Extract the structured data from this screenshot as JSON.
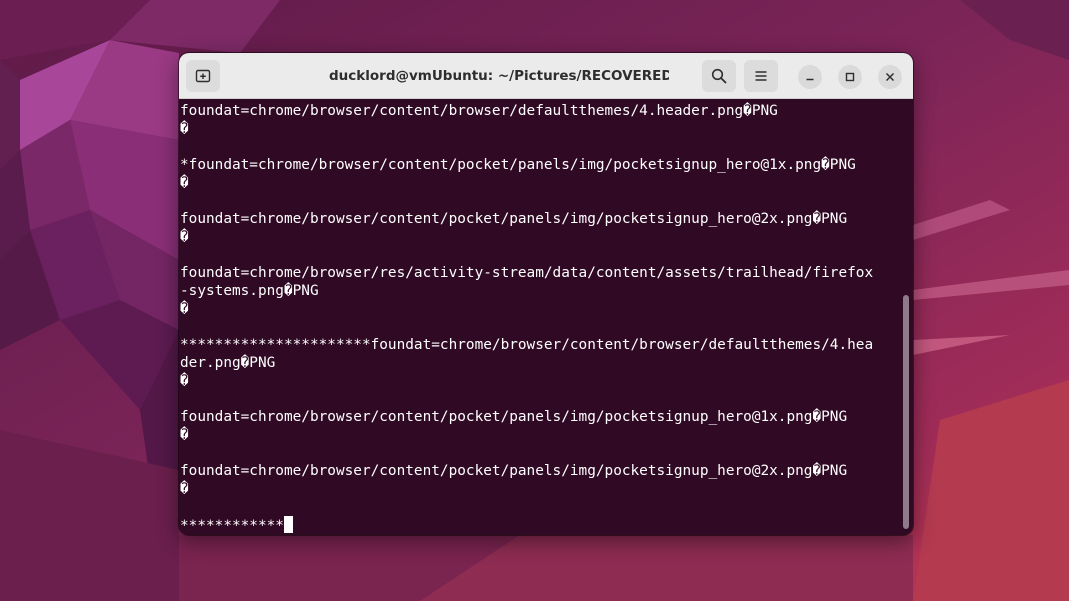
{
  "window": {
    "title": "ducklord@vmUbuntu: ~/Pictures/RECOVERED"
  },
  "headerbar": {
    "icons": {
      "new_tab": "new-tab-icon",
      "search": "search-icon",
      "menu": "hamburger-menu-icon",
      "minimize": "minimize-icon",
      "maximize": "maximize-icon",
      "close": "close-icon"
    }
  },
  "terminal": {
    "lines": [
      "foundat=chrome/browser/content/browser/defaultthemes/4.header.png�PNG",
      "�",
      "",
      "*foundat=chrome/browser/content/pocket/panels/img/pocketsignup_hero@1x.png�PNG",
      "�",
      "",
      "foundat=chrome/browser/content/pocket/panels/img/pocketsignup_hero@2x.png�PNG",
      "�",
      "",
      "foundat=chrome/browser/res/activity-stream/data/content/assets/trailhead/firefox",
      "-systems.png�PNG",
      "�",
      "",
      "**********************foundat=chrome/browser/content/browser/defaultthemes/4.hea",
      "der.png�PNG",
      "�",
      "",
      "foundat=chrome/browser/content/pocket/panels/img/pocketsignup_hero@1x.png�PNG",
      "�",
      "",
      "foundat=chrome/browser/content/pocket/panels/img/pocketsignup_hero@2x.png�PNG",
      "�",
      ""
    ],
    "prompt_line": "************"
  },
  "colors": {
    "terminal_bg": "#300a24",
    "terminal_fg": "#ffffff",
    "headerbar_bg": "#ebebeb",
    "wallpaper_base": "#7a2458"
  }
}
